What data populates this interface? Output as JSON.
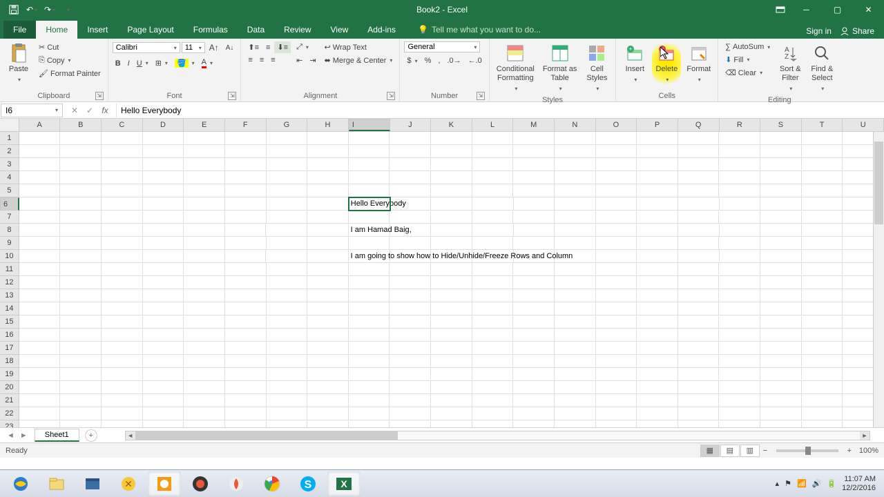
{
  "title": "Book2 - Excel",
  "qat": {
    "save": "💾",
    "undo": "↶",
    "redo": "↷"
  },
  "tabs": {
    "file": "File",
    "list": [
      "Home",
      "Insert",
      "Page Layout",
      "Formulas",
      "Data",
      "Review",
      "View",
      "Add-ins"
    ],
    "active": "Home",
    "tellme_placeholder": "Tell me what you want to do...",
    "signin": "Sign in",
    "share": "Share"
  },
  "ribbon": {
    "clipboard": {
      "label": "Clipboard",
      "paste": "Paste",
      "cut": "Cut",
      "copy": "Copy",
      "painter": "Format Painter"
    },
    "font": {
      "label": "Font",
      "name": "Calibri",
      "size": "11"
    },
    "alignment": {
      "label": "Alignment",
      "wrap": "Wrap Text",
      "merge": "Merge & Center"
    },
    "number": {
      "label": "Number",
      "format": "General"
    },
    "styles": {
      "label": "Styles",
      "cond": "Conditional\nFormatting",
      "table": "Format as\nTable",
      "cell": "Cell\nStyles"
    },
    "cells": {
      "label": "Cells",
      "insert": "Insert",
      "delete": "Delete",
      "format": "Format"
    },
    "editing": {
      "label": "Editing",
      "autosum": "AutoSum",
      "fill": "Fill",
      "clear": "Clear",
      "sort": "Sort &\nFilter",
      "find": "Find &\nSelect"
    }
  },
  "namebox": "I6",
  "formula": "Hello Everybody",
  "columns": [
    "A",
    "B",
    "C",
    "D",
    "E",
    "F",
    "G",
    "H",
    "I",
    "J",
    "K",
    "L",
    "M",
    "N",
    "O",
    "P",
    "Q",
    "R",
    "S",
    "T",
    "U"
  ],
  "active_col": "I",
  "active_row": 6,
  "rows_count": 23,
  "cells": {
    "6": {
      "I": "Hello Everybody"
    },
    "8": {
      "I": "I am Hamad Baig,"
    },
    "10": {
      "I": "I am going to show how to Hide/Unhide/Freeze Rows and Column"
    }
  },
  "sheet": {
    "name": "Sheet1"
  },
  "status": {
    "ready": "Ready",
    "zoom": "100%"
  },
  "tray": {
    "time": "11:07 AM",
    "date": "12/2/2016"
  }
}
